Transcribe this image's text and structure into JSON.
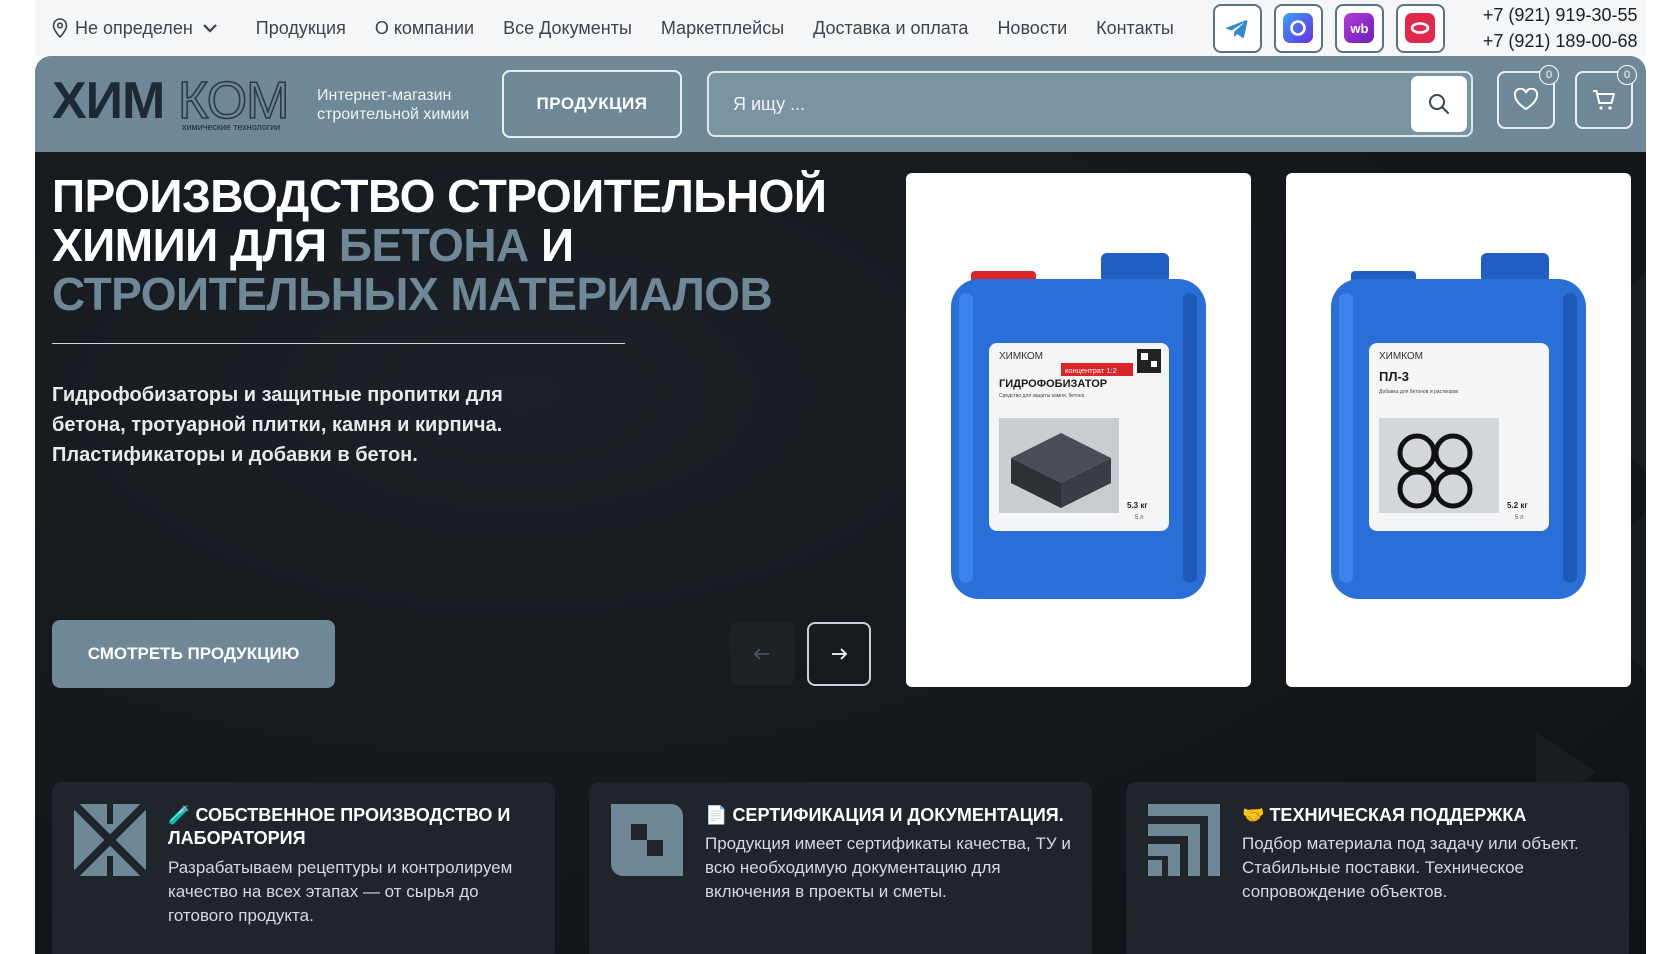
{
  "topbar": {
    "location": "Не определен",
    "nav": [
      "Продукция",
      "О компании",
      "Все Документы",
      "Маркетплейсы",
      "Доставка и оплата",
      "Новости",
      "Контакты"
    ],
    "socials": [
      {
        "icon": "telegram-icon",
        "color": "#2c8bd6"
      },
      {
        "icon": "max-messenger-icon",
        "color": "#4a57e6"
      },
      {
        "icon": "wildberries-icon",
        "color": "#8e2bd1",
        "label": "wb"
      },
      {
        "icon": "ozon-icon",
        "color": "#e0294b"
      }
    ],
    "phones": [
      "+7 (921) 919-30-55",
      "+7 (921) 189-00-68"
    ]
  },
  "header": {
    "logo_text": "ХИМКОМ",
    "logo_sub": "химические технологии",
    "tagline_1": "Интернет-магазин",
    "tagline_2": "строительной химии",
    "products_button": "ПРОДУКЦИЯ",
    "search_placeholder": "Я ищу ...",
    "favorites_count": "0",
    "cart_count": "0"
  },
  "hero": {
    "title_1": "ПРОИЗВОДСТВО СТРОИТЕЛЬНОЙ",
    "title_2": "ХИМИИ ДЛЯ ",
    "title_accent_1": "БЕТОНА",
    "title_3": " И",
    "title_accent_2": "СТРОИТЕЛЬНЫХ МАТЕРИАЛОВ",
    "lead_1": "Гидрофобизаторы и защитные пропитки для",
    "lead_2": "бетона, тротуарной плитки, камня и кирпича.",
    "lead_3": "Пластификаторы и добавки в бетон.",
    "cta": "СМОТРЕТЬ ПРОДУКЦИЮ",
    "products": [
      {
        "brand": "ХИМКОМ",
        "sticker": "концентрат 1:2",
        "name": "ГИДРОФОБИЗАТОР",
        "desc": "Средство для защиты камня, бетона",
        "weight": "5.3 кг",
        "volume": "5 л"
      },
      {
        "brand": "ХИМКОМ",
        "name": "ПЛ-3",
        "desc": "Добавка для бетонов и растворов",
        "weight": "5.2 кг",
        "volume": "5 л"
      }
    ]
  },
  "features": [
    {
      "emoji": "🧪",
      "title": "СОБСТВЕННОЕ ПРОИЗВОДСТВО И ЛАБОРАТОРИЯ",
      "text": "Разрабатываем рецептуры и контролируем качество на всех этапах — от сырья до готового продукта."
    },
    {
      "emoji": "📄",
      "title": "СЕРТИФИКАЦИЯ И ДОКУМЕНТАЦИЯ.",
      "text": "Продукция имеет сертификаты качества, ТУ и всю необходимую документацию для включения в проекты и сметы."
    },
    {
      "emoji": "🤝",
      "title": "ТЕХНИЧЕСКАЯ ПОДДЕРЖКА",
      "text": "Подбор материала под задачу или объект. Стабильные поставки. Техническое сопровождение объектов."
    }
  ],
  "colors": {
    "accent": "#6f8897",
    "dark_bg": "#14181c",
    "canister_blue": "#2a6fd8"
  }
}
